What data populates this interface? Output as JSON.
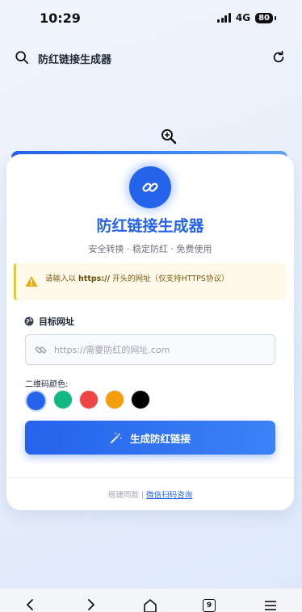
{
  "status": {
    "time": "10:29",
    "network": "4G",
    "battery": "80"
  },
  "browser": {
    "url_text": "防红链接生成器",
    "tab_count": "9"
  },
  "app": {
    "title": "防红链接生成器",
    "subtitle": "安全转换 · 稳定防红 · 免费使用",
    "notice": {
      "before": "请输入以 ",
      "highlight": "https://",
      "after": " 开头的网址（仅支持HTTPS协议）"
    },
    "field_label": "目标网址",
    "input_placeholder": "https://需要防红的网址.com",
    "input_value": "",
    "color_label": "二维码颜色:",
    "colors": [
      "#2563eb",
      "#10b981",
      "#ef4444",
      "#f59e0b",
      "#000000"
    ],
    "selected_color": 0,
    "generate_label": "生成防红链接",
    "footer": {
      "text": "搭建同款 | ",
      "link": "微信扫码咨询"
    }
  },
  "icons": [
    "search-icon",
    "reload-icon",
    "link-icon",
    "warning-icon",
    "globe-icon",
    "magic-wand-icon",
    "back-icon",
    "forward-icon",
    "home-icon",
    "tabs-icon",
    "menu-icon"
  ]
}
